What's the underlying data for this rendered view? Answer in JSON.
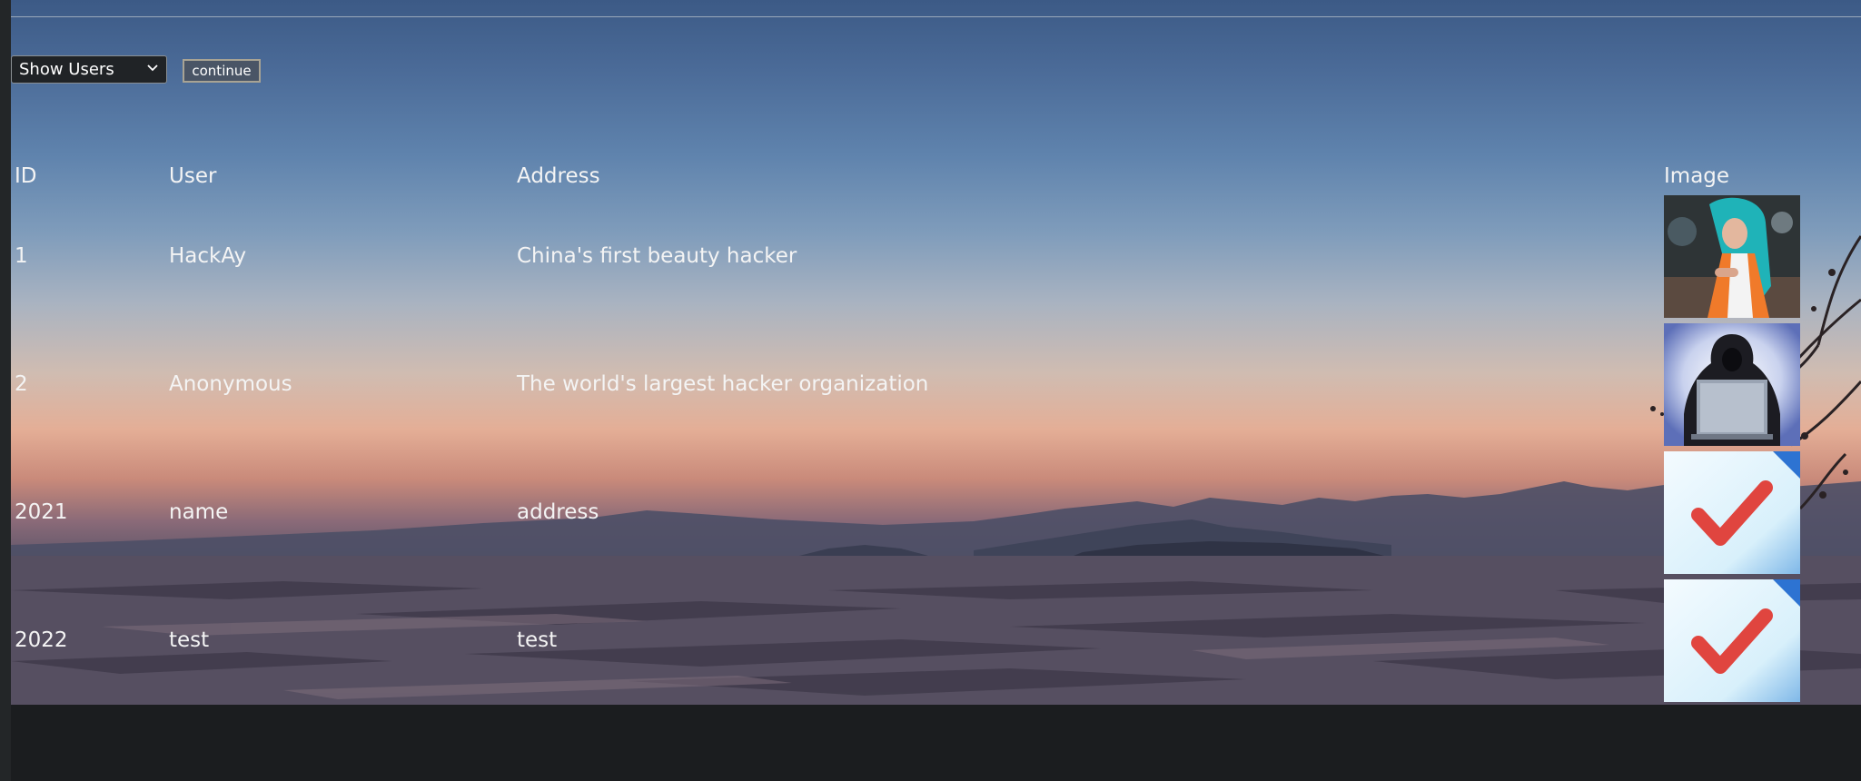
{
  "controls": {
    "view_select": {
      "selected": "Show Users"
    },
    "continue_label": "continue"
  },
  "table": {
    "headers": {
      "id": "ID",
      "user": "User",
      "address": "Address",
      "image": "Image"
    },
    "rows": [
      {
        "id": "1",
        "user": "HackAy",
        "address": "China's first beauty hacker",
        "image_icon": "hacker-girl-photo"
      },
      {
        "id": "2",
        "user": "Anonymous",
        "address": "The world's largest hacker organization",
        "image_icon": "hooded-hacker-laptop-photo"
      },
      {
        "id": "2021",
        "user": "name",
        "address": "address",
        "image_icon": "checkmark-icon"
      },
      {
        "id": "2022",
        "user": "test",
        "address": "test",
        "image_icon": "checkmark-icon"
      }
    ]
  },
  "colors": {
    "text": "#f4f4f4",
    "page_background": "#1b1d1f",
    "checkmark": "#e0322a"
  }
}
